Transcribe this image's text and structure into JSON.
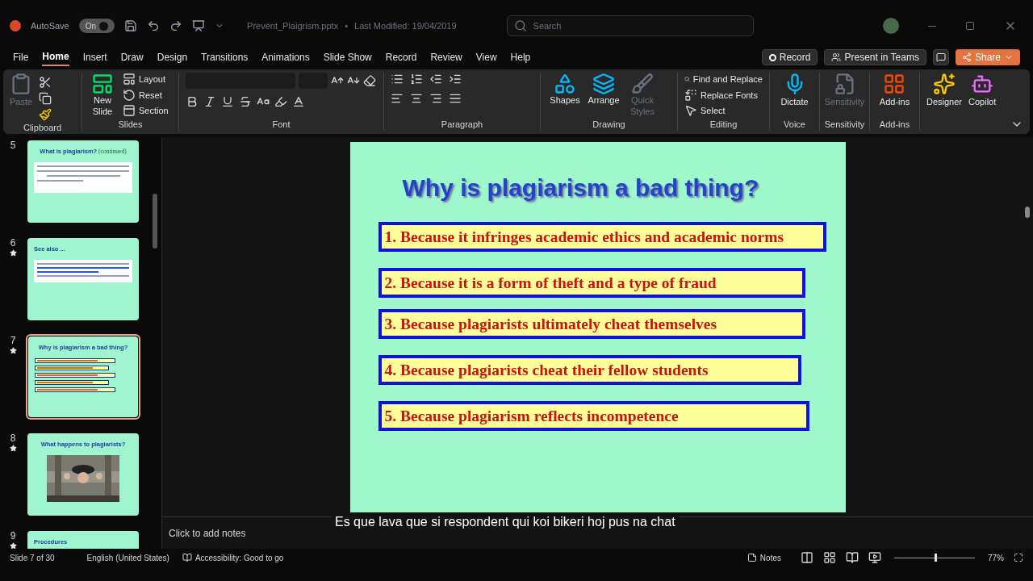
{
  "titlebar": {
    "autosave_label": "AutoSave",
    "autosave": {
      "label": "On",
      "on": true
    },
    "filename": "Prevent_Plaigrism.pptx",
    "separator": "•",
    "modified": "Last Modified: 19/04/2019",
    "search_placeholder": "Search"
  },
  "menu_tabs": [
    {
      "label": "File",
      "selected": false
    },
    {
      "label": "Home",
      "selected": true
    },
    {
      "label": "Insert",
      "selected": false
    },
    {
      "label": "Draw",
      "selected": false
    },
    {
      "label": "Design",
      "selected": false
    },
    {
      "label": "Transitions",
      "selected": false
    },
    {
      "label": "Animations",
      "selected": false
    },
    {
      "label": "Slide Show",
      "selected": false
    },
    {
      "label": "Record",
      "selected": false
    },
    {
      "label": "Review",
      "selected": false
    },
    {
      "label": "View",
      "selected": false
    },
    {
      "label": "Help",
      "selected": false
    }
  ],
  "action_buttons": [
    {
      "label": "Record",
      "kind": "record"
    },
    {
      "label": "Present in Teams",
      "kind": "teams"
    },
    {
      "label": "Share",
      "kind": "share"
    }
  ],
  "ribbon": {
    "clipboard": {
      "label": "Clipboard",
      "paste": {
        "label": "Paste",
        "disabled": true
      }
    },
    "slides": {
      "label": "Slides",
      "new_slide": "New Slide",
      "items": [
        "Layout",
        "Reset",
        "Section"
      ]
    },
    "font": {
      "label": "Font"
    },
    "paragraph": {
      "label": "Paragraph"
    },
    "drawing": {
      "label": "Drawing",
      "buttons": [
        {
          "label": "Shapes",
          "disabled": false
        },
        {
          "label": "Arrange",
          "disabled": false
        },
        {
          "label": "Quick Styles",
          "disabled": true
        }
      ]
    },
    "editing": {
      "label": "Editing",
      "items": [
        "Find and Replace",
        "Replace Fonts",
        "Select"
      ]
    },
    "voice": {
      "label": "Voice",
      "button": {
        "label": "Dictate",
        "disabled": false
      }
    },
    "sensitivity": {
      "label": "Sensitivity",
      "button": {
        "label": "Sensitivity",
        "disabled": true
      }
    },
    "addins": {
      "label": "Add-ins",
      "button": {
        "label": "Add-ins",
        "disabled": false
      }
    },
    "ai": {
      "buttons": [
        "Designer",
        "Copilot"
      ]
    }
  },
  "thumbnails": [
    {
      "number": "5",
      "starred": false,
      "selected": false,
      "kind": "text",
      "title": "What is plagiarism?",
      "title_suffix": "(continued)"
    },
    {
      "number": "6",
      "starred": true,
      "selected": false,
      "kind": "links",
      "title": "See also ..."
    },
    {
      "number": "7",
      "starred": true,
      "selected": true,
      "kind": "list",
      "title": "Why is plagiarism a bad thing?"
    },
    {
      "number": "8",
      "starred": true,
      "selected": false,
      "title": "What happens to plagiarists?"
    },
    {
      "number": "9",
      "starred": true,
      "selected": false,
      "kind": "text",
      "title": "Procedures"
    }
  ],
  "slide": {
    "title": "Why is plagiarism a bad thing?",
    "items": [
      "1. Because it infringes academic ethics and academic norms",
      "2. Because it is a form of theft and a type of fraud",
      "3. Because plagiarists ultimately cheat themselves",
      "4. Because plagiarists cheat their fellow students",
      "5. Because plagiarism reflects incompetence"
    ]
  },
  "notes_placeholder": "Click to add notes",
  "caption": "Es que lava que si respondent qui koi bikeri hoj pus na chat",
  "status_bar": {
    "slide": "Slide 7 of 30",
    "language": "English (United States)",
    "accessibility": "Accessibility: Good to go",
    "notes": "Notes",
    "zoom": {
      "level": 0.5,
      "label": "77%"
    }
  }
}
